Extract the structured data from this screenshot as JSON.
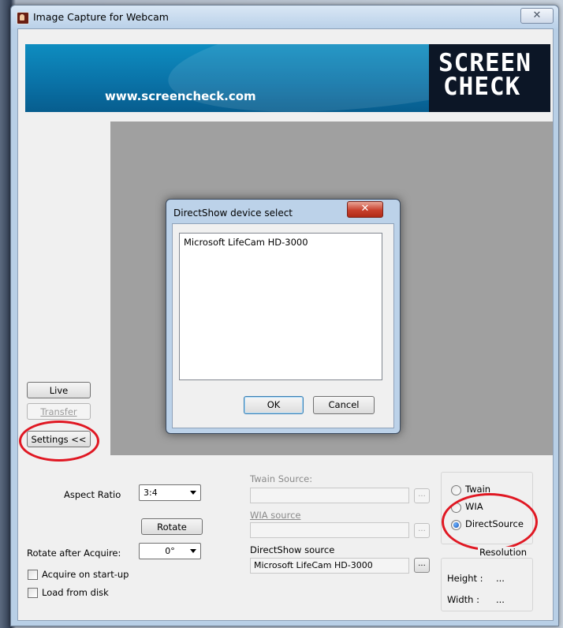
{
  "window": {
    "title": "Image Capture for Webcam",
    "close_glyph": "✕"
  },
  "banner": {
    "url": "www.screencheck.com",
    "logo_line1": "SCREEN",
    "logo_line2": "CHECK"
  },
  "left_buttons": {
    "live": "Live",
    "transfer": "Transfer",
    "settings": "Settings <<"
  },
  "dialog": {
    "title": "DirectShow device select",
    "close_glyph": "✕",
    "devices": [
      "Microsoft LifeCam HD-3000"
    ],
    "ok": "OK",
    "cancel": "Cancel"
  },
  "controls": {
    "aspect_ratio_label": "Aspect Ratio",
    "aspect_ratio_value": "3:4",
    "rotate_button": "Rotate",
    "rotate_after_label": "Rotate after Acquire:",
    "rotate_after_value": "0°",
    "acquire_on_startup": "Acquire on start-up",
    "load_from_disk": "Load from disk"
  },
  "sources": {
    "twain_label": "Twain Source:",
    "twain_value": "",
    "wia_label": "WIA source",
    "wia_value": "",
    "directshow_label": "DirectShow source",
    "directshow_value": "Microsoft LifeCam HD-3000",
    "browse_glyph": "..."
  },
  "source_type": {
    "options": [
      "Twain",
      "WIA",
      "DirectSource"
    ],
    "selected": "DirectSource"
  },
  "resolution": {
    "title": "Resolution",
    "height_label": "Height :",
    "height_value": "...",
    "width_label": "Width :",
    "width_value": "..."
  },
  "colors": {
    "highlight_ellipse": "#e01823",
    "banner_blue": "#0a73a8"
  }
}
